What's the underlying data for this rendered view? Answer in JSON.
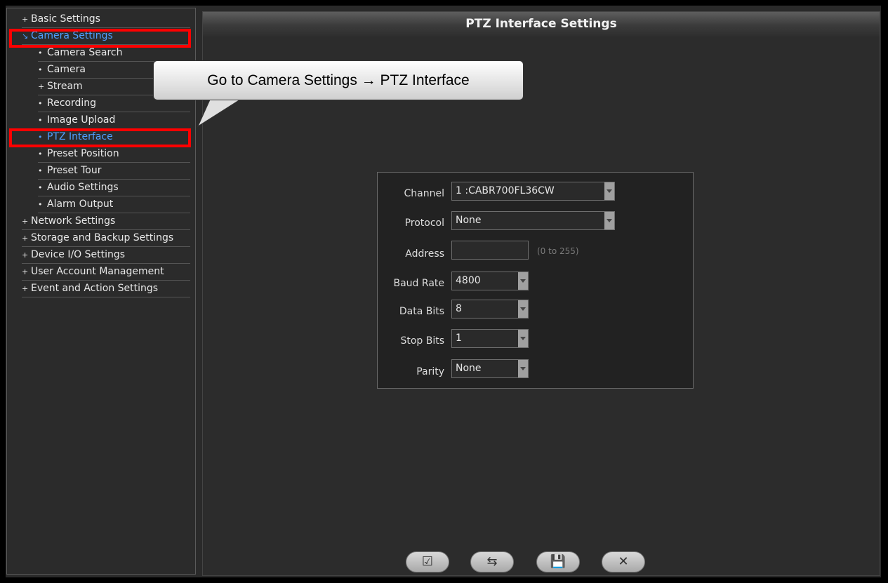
{
  "sidebar": {
    "items": [
      {
        "label": "Basic Settings",
        "marker": "+"
      },
      {
        "label": "Camera Settings",
        "marker": "↘"
      },
      {
        "label": "Camera Search",
        "marker": "•"
      },
      {
        "label": "Camera",
        "marker": "•"
      },
      {
        "label": "Stream",
        "marker": "+"
      },
      {
        "label": "Recording",
        "marker": "•"
      },
      {
        "label": "Image Upload",
        "marker": "•"
      },
      {
        "label": "PTZ Interface",
        "marker": "•"
      },
      {
        "label": "Preset Position",
        "marker": "•"
      },
      {
        "label": "Preset Tour",
        "marker": "•"
      },
      {
        "label": "Audio Settings",
        "marker": "•"
      },
      {
        "label": "Alarm Output",
        "marker": "•"
      },
      {
        "label": "Network Settings",
        "marker": "+"
      },
      {
        "label": "Storage and Backup Settings",
        "marker": "+"
      },
      {
        "label": "Device I/O Settings",
        "marker": "+"
      },
      {
        "label": "User Account Management",
        "marker": "+"
      },
      {
        "label": "Event and Action Settings",
        "marker": "+"
      }
    ],
    "active_color": "#4f9fff",
    "highlight_color": "#ff0000"
  },
  "main": {
    "title": "PTZ Interface Settings"
  },
  "callout": {
    "text": "Go to Camera Settings → PTZ Interface"
  },
  "form": {
    "channel": {
      "label": "Channel",
      "value": "1 :CABR700FL36CW"
    },
    "protocol": {
      "label": "Protocol",
      "value": "None"
    },
    "address": {
      "label": "Address",
      "value": "",
      "hint": "(0 to 255)"
    },
    "baud_rate": {
      "label": "Baud Rate",
      "value": "4800"
    },
    "data_bits": {
      "label": "Data Bits",
      "value": "8"
    },
    "stop_bits": {
      "label": "Stop Bits",
      "value": "1"
    },
    "parity": {
      "label": "Parity",
      "value": "None"
    }
  },
  "buttons": [
    {
      "icon": "apply-check-icon",
      "glyph": "☑"
    },
    {
      "icon": "refresh-arrows-icon",
      "glyph": "⇆"
    },
    {
      "icon": "save-disk-icon",
      "glyph": "💾"
    },
    {
      "icon": "close-x-icon",
      "glyph": "✕"
    }
  ]
}
